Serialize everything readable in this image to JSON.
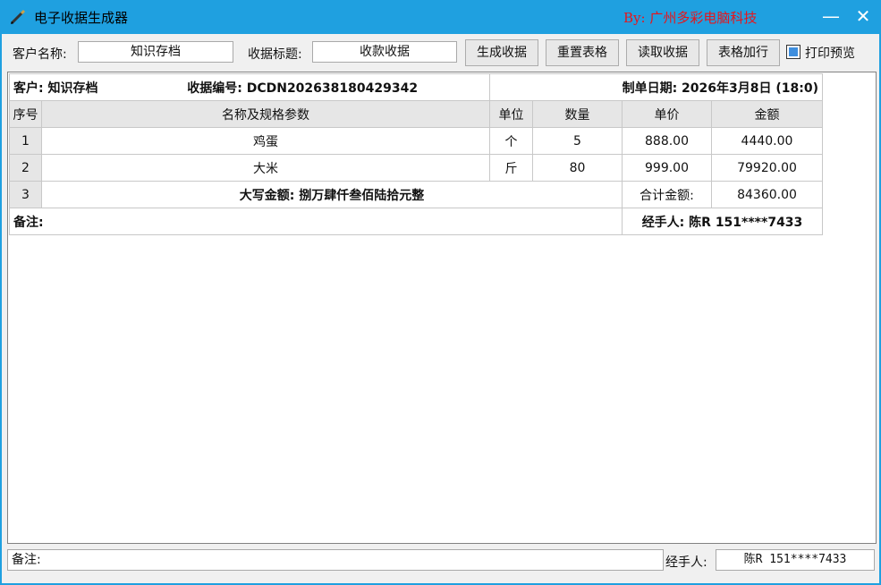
{
  "window": {
    "title": "电子收据生成器",
    "author": "By: 广州多彩电脑科技",
    "minimize_glyph": "—",
    "close_glyph": "✕"
  },
  "toolbar": {
    "customer_label": "客户名称:",
    "customer_value": "知识存档",
    "receipt_title_label": "收据标题:",
    "receipt_title_value": "收款收据",
    "generate_button": "生成收据",
    "reset_button": "重置表格",
    "read_button": "读取收据",
    "add_row_button": "表格加行",
    "print_preview_label": "打印预览",
    "print_preview_checked": true
  },
  "receipt": {
    "customer": "客户: 知识存档",
    "receipt_no": "收据编号: DCDN202638180429342",
    "date": "制单日期: 2026年3月8日 (18:0)",
    "columns": [
      "序号",
      "名称及规格参数",
      "单位",
      "数量",
      "单价",
      "金额"
    ],
    "rows": [
      {
        "seq": "1",
        "name": "鸡蛋",
        "unit": "个",
        "qty": "5",
        "price": "888.00",
        "amount": "4440.00"
      },
      {
        "seq": "2",
        "name": "大米",
        "unit": "斤",
        "qty": "80",
        "price": "999.00",
        "amount": "79920.00"
      }
    ],
    "total_seq": "3",
    "total_upper": "大写金额: 捌万肆仟叁佰陆拾元整",
    "total_label": "合计金额:",
    "total_value": "84360.00",
    "remark": "备注:",
    "handler": "经手人: 陈R 151****7433"
  },
  "footer": {
    "remark_label": "备注:",
    "handler_label": "经手人:",
    "handler_value": "陈R 151****7433"
  }
}
